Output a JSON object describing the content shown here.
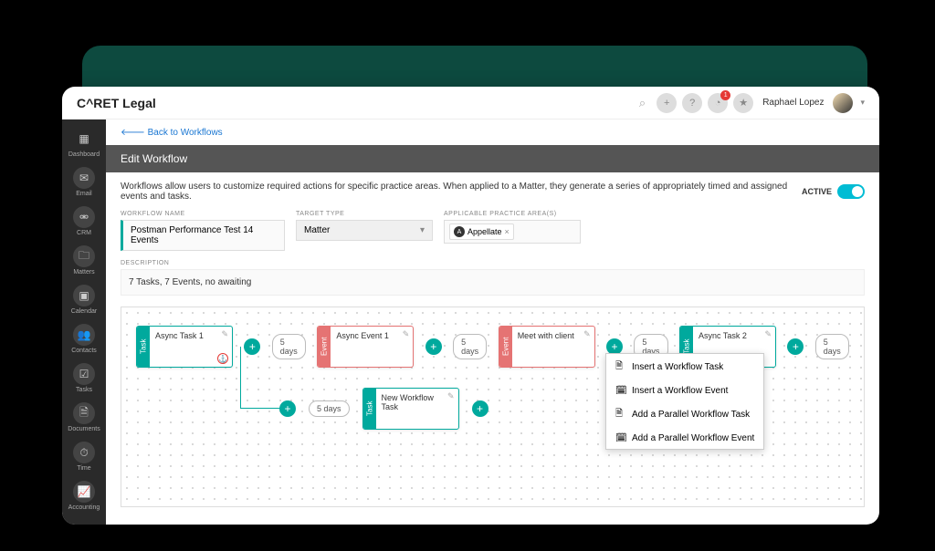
{
  "app": {
    "logo": "C^RET Legal",
    "username": "Raphael Lopez",
    "notif_count": "1"
  },
  "sidebar": {
    "items": [
      {
        "label": "Dashboard"
      },
      {
        "label": "Email"
      },
      {
        "label": "CRM"
      },
      {
        "label": "Matters"
      },
      {
        "label": "Calendar"
      },
      {
        "label": "Contacts"
      },
      {
        "label": "Tasks"
      },
      {
        "label": "Documents"
      },
      {
        "label": "Time"
      },
      {
        "label": "Accounting"
      }
    ]
  },
  "page": {
    "back_link": "Back to Workflows",
    "title": "Edit Workflow",
    "intro": "Workflows allow users to customize required actions for specific practice areas. When applied to a Matter, they generate a series of appropriately timed and assigned events and tasks.",
    "active_label": "ACTIVE",
    "labels": {
      "name": "WORKFLOW NAME",
      "target": "TARGET TYPE",
      "area": "APPLICABLE PRACTICE AREA(S)",
      "desc": "DESCRIPTION"
    },
    "name_value": "Postman Performance Test  14 Events",
    "target_value": "Matter",
    "area_tag": "Appellate",
    "description": "7 Tasks, 7 Events, no awaiting"
  },
  "flow": {
    "tab_task": "Task",
    "tab_event": "Event",
    "nodes": {
      "n1": "Async Task 1",
      "n2": "Async Event 1",
      "n3": "Meet with client",
      "n4": "Async Task 2",
      "n5": "New Workflow Task"
    },
    "duration": "5 days"
  },
  "menu": {
    "i1": "Insert a Workflow Task",
    "i2": "Insert a Workflow Event",
    "i3": "Add a Parallel Workflow Task",
    "i4": "Add a Parallel Workflow Event"
  }
}
